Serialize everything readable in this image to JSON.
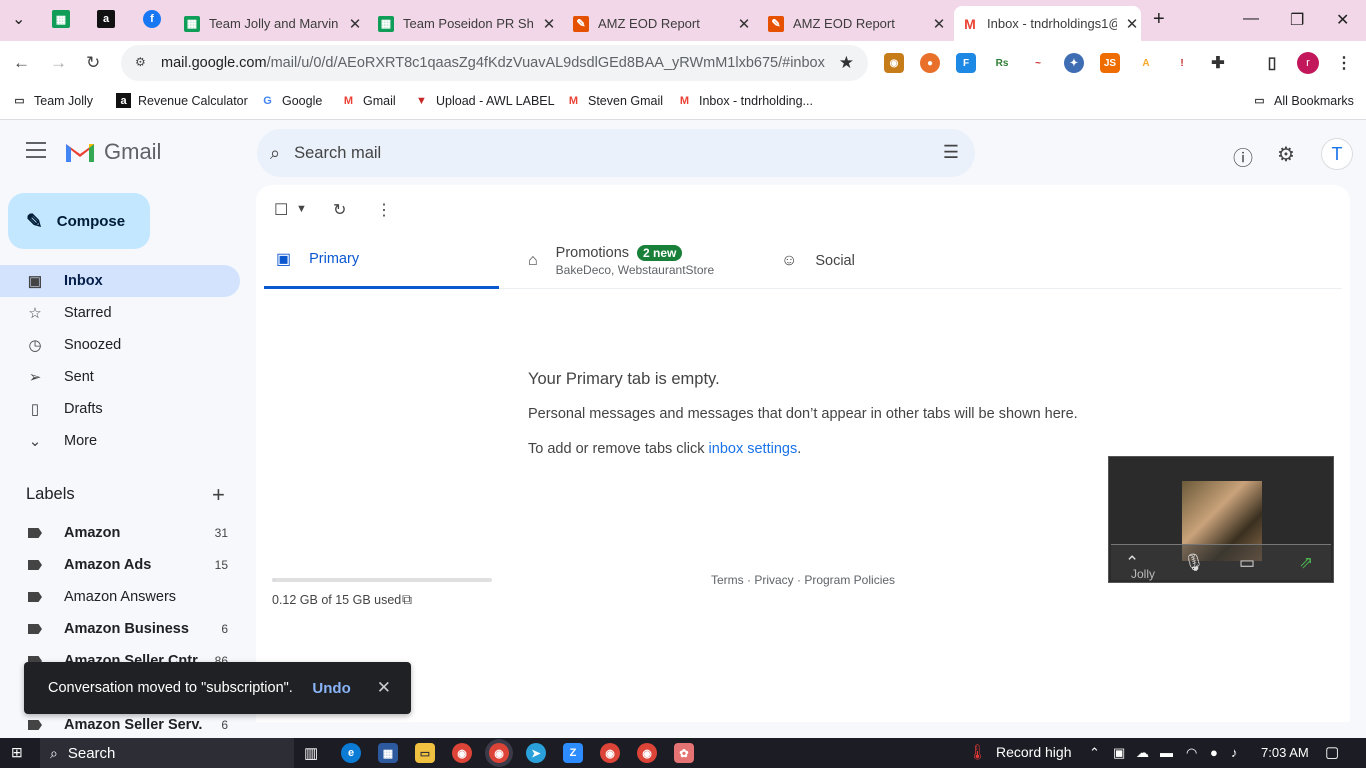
{
  "browser": {
    "tabs": [
      {
        "title": "Team Jolly and Marvin",
        "icon": "sheets-icon",
        "color": "#0f9d58"
      },
      {
        "title": "Team Poseidon PR She",
        "icon": "sheets-icon",
        "color": "#0f9d58"
      },
      {
        "title": "AMZ EOD Report",
        "icon": "eod-icon",
        "color": "#e65100"
      },
      {
        "title": "AMZ EOD Report",
        "icon": "eod-icon",
        "color": "#e65100"
      },
      {
        "title": "Inbox - tndrholdings1@",
        "icon": "gmail-icon",
        "color": "#ea4335"
      }
    ],
    "url_host": "mail.google.com",
    "url_path": "/mail/u/0/d/AEoRXRT8c1qaasZg4fKdzVuavAL9dsdlGEd8BAA_yRWmM1lxb675/#inbox",
    "profile_initial": "r",
    "bookmarks": [
      {
        "label": "Team Jolly",
        "icon": "folder-icon"
      },
      {
        "label": "Revenue Calculator",
        "icon": "amazon-icon"
      },
      {
        "label": "Google",
        "icon": "google-icon"
      },
      {
        "label": "Gmail",
        "icon": "gmail-icon"
      },
      {
        "label": "Upload - AWL LABEL",
        "icon": "awl-icon"
      },
      {
        "label": "Steven Gmail",
        "icon": "gmail-icon"
      },
      {
        "label": "Inbox - tndrholding...",
        "icon": "gmail-icon"
      }
    ],
    "all_bookmarks": "All Bookmarks"
  },
  "gmail": {
    "logo_text": "Gmail",
    "search_placeholder": "Search mail",
    "avatar_initial": "T",
    "compose": "Compose",
    "nav": [
      {
        "label": "Inbox",
        "icon": "inbox-icon",
        "active": true
      },
      {
        "label": "Starred",
        "icon": "star-icon"
      },
      {
        "label": "Snoozed",
        "icon": "clock-icon"
      },
      {
        "label": "Sent",
        "icon": "send-icon"
      },
      {
        "label": "Drafts",
        "icon": "draft-icon"
      },
      {
        "label": "More",
        "icon": "chevron-down-icon"
      }
    ],
    "labels_heading": "Labels",
    "labels": [
      {
        "name": "Amazon",
        "count": "31",
        "bold": true
      },
      {
        "name": "Amazon Ads",
        "count": "15",
        "bold": true
      },
      {
        "name": "Amazon Answers",
        "count": "",
        "bold": false
      },
      {
        "name": "Amazon Business",
        "count": "6",
        "bold": true
      },
      {
        "name": "Amazon Seller Cntr",
        "count": "86",
        "bold": true
      },
      {
        "name": "Amazon Seller Serv.",
        "count": "6",
        "bold": true
      }
    ],
    "tabs": [
      {
        "label": "Primary",
        "icon": "inbox-icon",
        "active": true
      },
      {
        "label": "Promotions",
        "icon": "tag-icon",
        "badge": "2 new",
        "sub": "BakeDeco, WebstaurantStore"
      },
      {
        "label": "Social",
        "icon": "people-icon"
      }
    ],
    "empty_title": "Your Primary tab is empty.",
    "empty_desc": "Personal messages and messages that don’t appear in other tabs will be shown here.",
    "empty_settings_prefix": "To add or remove tabs click ",
    "empty_settings_link": "inbox settings",
    "empty_settings_suffix": ".",
    "storage_text": "0.12 GB of 15 GB used",
    "storage_fraction": 0.008,
    "footer": "Terms · Privacy · Program Policies"
  },
  "pip": {
    "name": "Jolly"
  },
  "snackbar": {
    "message": "Conversation moved to \"subscription\".",
    "undo": "Undo"
  },
  "taskbar": {
    "search": "Search",
    "weather": "Record high",
    "time": "7:03 AM"
  }
}
